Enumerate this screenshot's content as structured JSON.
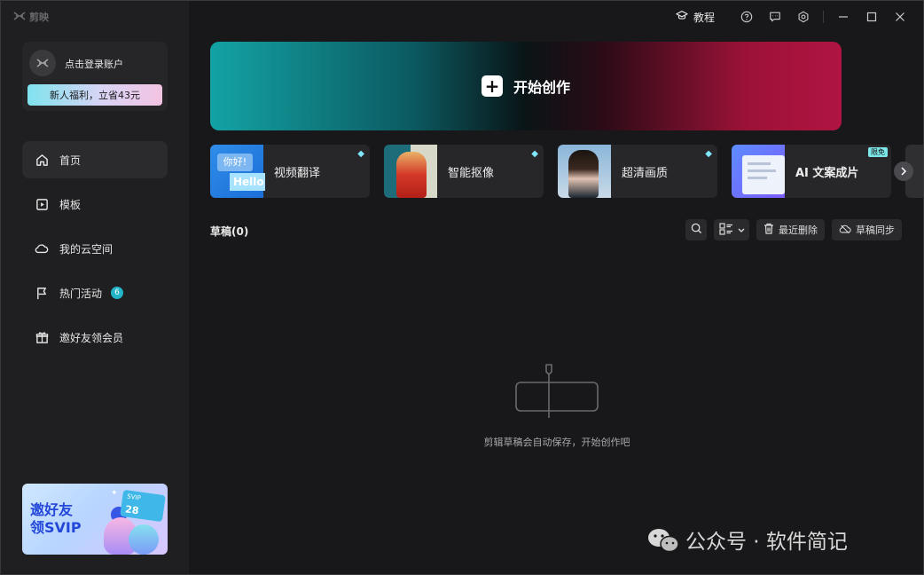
{
  "app": {
    "name": "剪映"
  },
  "titlebar": {
    "tutorial_label": "教程",
    "icons": [
      "help-icon",
      "feedback-icon",
      "settings-icon",
      "minimize-icon",
      "maximize-icon",
      "close-icon"
    ]
  },
  "sidebar": {
    "login_text": "点击登录账户",
    "welfare_label": "新人福利，立省43元",
    "items": [
      {
        "label": "首页",
        "icon": "home-icon",
        "active": true
      },
      {
        "label": "模板",
        "icon": "template-icon"
      },
      {
        "label": "我的云空间",
        "icon": "cloud-icon"
      },
      {
        "label": "热门活动",
        "icon": "flag-icon",
        "badge": "6"
      },
      {
        "label": "邀好友领会员",
        "icon": "gift-icon"
      }
    ],
    "promo": {
      "line1": "邀好友",
      "line2": "领SVIP",
      "card_label": "SVIP",
      "card_value": "28"
    }
  },
  "hero": {
    "label": "开始创作"
  },
  "features": [
    {
      "label": "视频翻译",
      "thumb_text_1": "你好!",
      "thumb_text_2": "Hello",
      "tag": "diamond"
    },
    {
      "label": "智能抠像",
      "tag": "diamond"
    },
    {
      "label": "超清画质",
      "tag": "diamond"
    },
    {
      "label": "AI 文案成片",
      "tag": "限免"
    }
  ],
  "drafts": {
    "title": "草稿(0)",
    "recent_delete_label": "最近删除",
    "sync_label": "草稿同步",
    "empty_text": "剪辑草稿会自动保存，开始创作吧"
  },
  "watermark": {
    "text": "公众号 · 软件简记"
  },
  "colors": {
    "accent_teal": "#13a3a4",
    "accent_magenta": "#b01442",
    "badge": "#22b5c9"
  }
}
